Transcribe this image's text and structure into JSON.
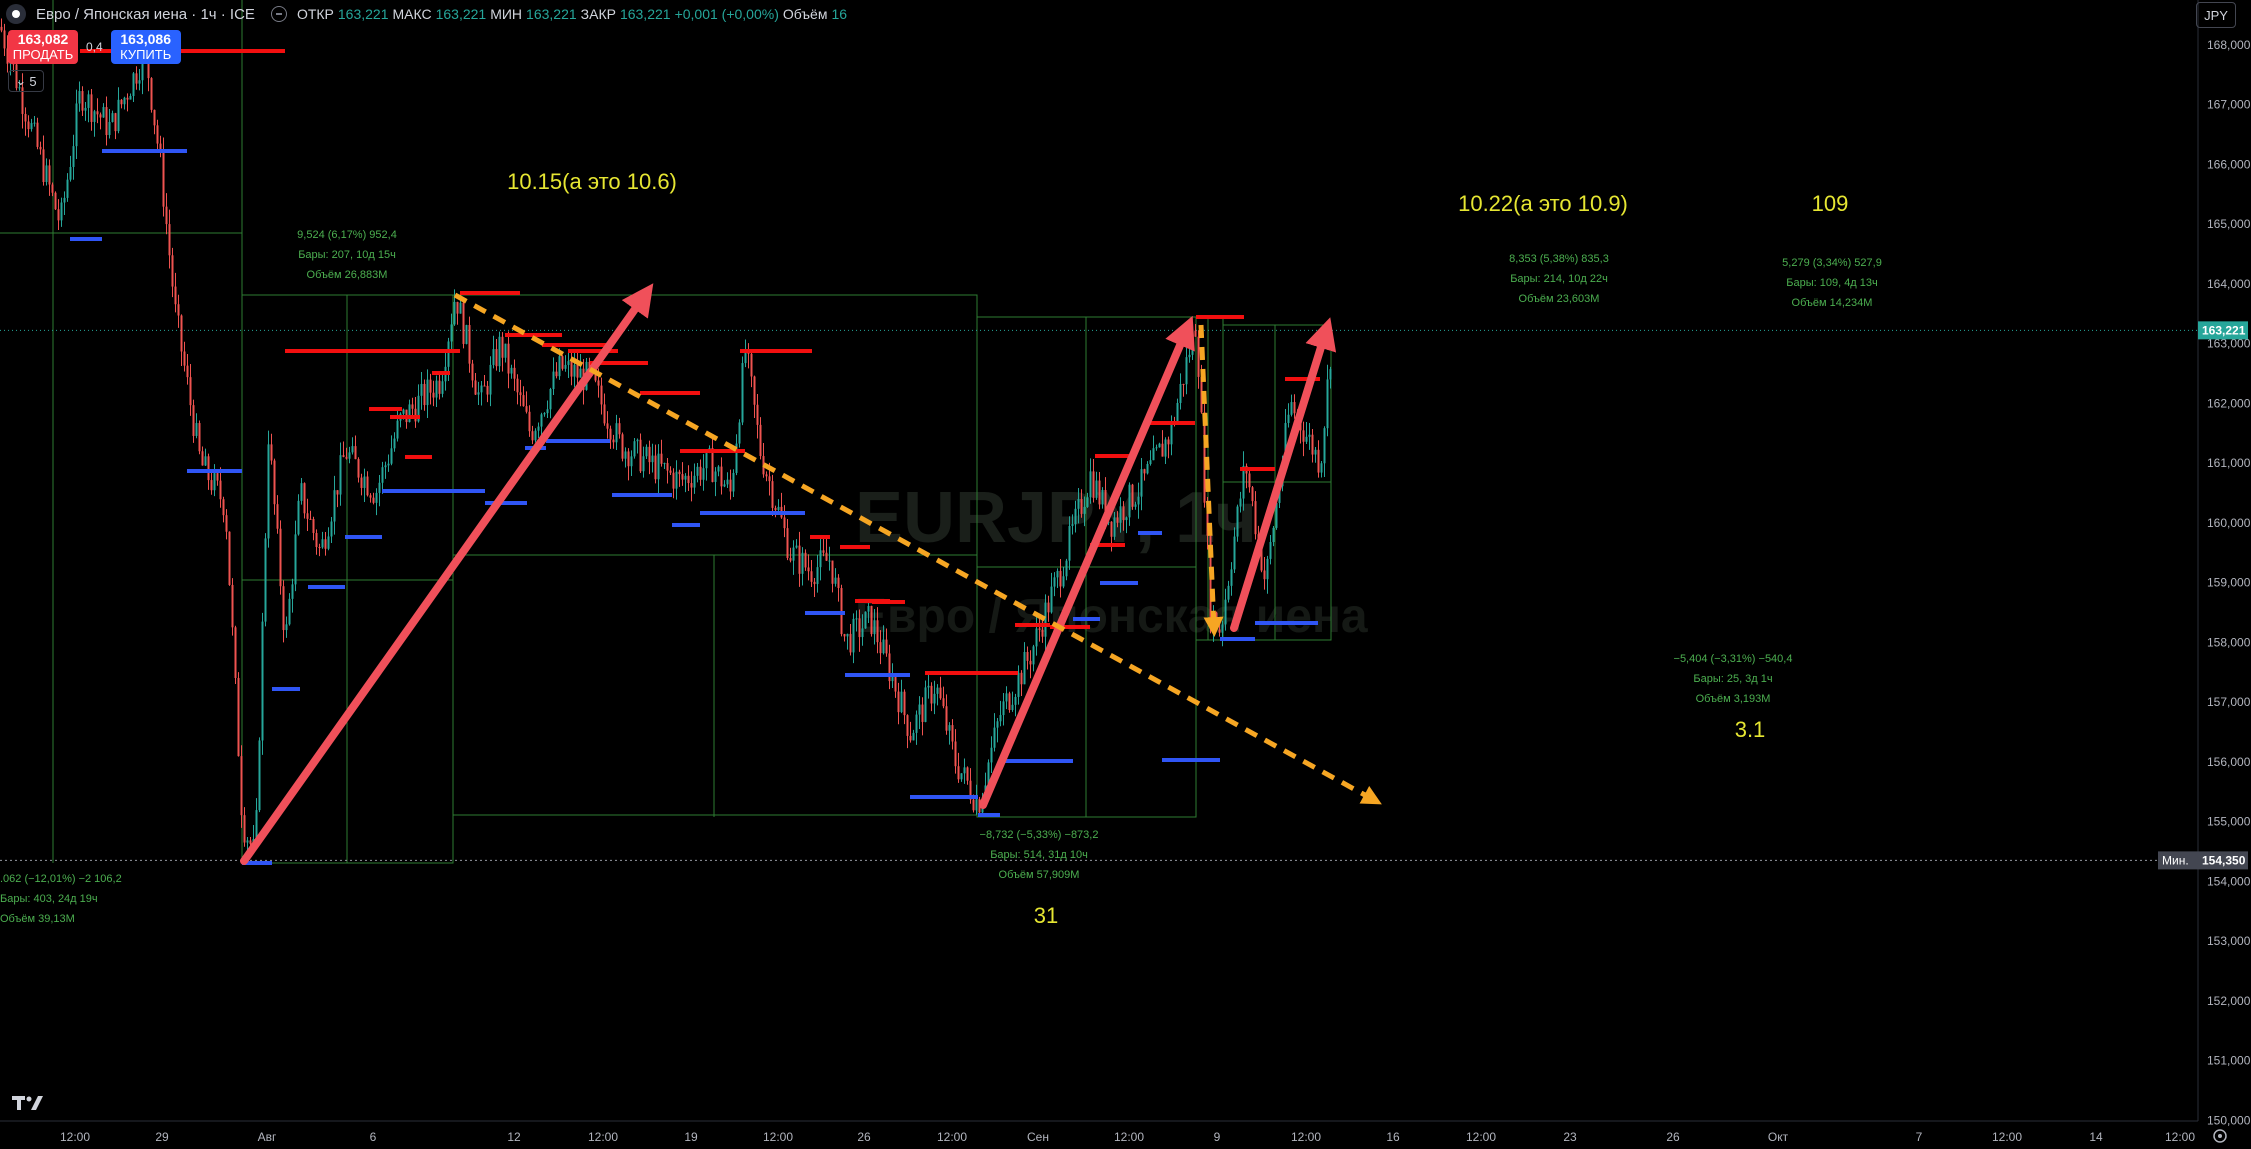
{
  "header": {
    "symbol": "Евро / Японская иена · 1ч · ICE",
    "ohlc": [
      {
        "label": "ОТКР",
        "value": "163,221"
      },
      {
        "label": "МАКС",
        "value": "163,221"
      },
      {
        "label": "МИН",
        "value": "163,221"
      },
      {
        "label": "ЗАКР",
        "value": "163,221"
      },
      {
        "label": "",
        "value": "+0,001 (+0,00%)"
      },
      {
        "label": "Объём",
        "value": "16"
      }
    ]
  },
  "trade": {
    "sell_price": "163,082",
    "sell_label": "ПРОДАТЬ",
    "spread": "0,4",
    "buy_price": "163,086",
    "buy_label": "КУПИТЬ",
    "collapse_count": "5"
  },
  "currency": "JPY",
  "watermark": {
    "line1": "EURJPY, 1ч",
    "line2": "Евро / Японская иена"
  },
  "colors": {
    "up": "#26a69a",
    "down": "#ef5350",
    "red_level": "#f20f0f",
    "blue_level": "#2f55f5",
    "arrow": "#f0505a",
    "dashed": "#f6a623",
    "annot": "#e6e632",
    "measure": "#2e7d32"
  },
  "chart_data": {
    "type": "candlestick",
    "y_axis": {
      "range": [
        150.2,
        168.5
      ],
      "ticks": [
        "168,000",
        "167,000",
        "166,000",
        "165,000",
        "164,000",
        "163,000",
        "162,000",
        "161,000",
        "160,000",
        "159,000",
        "158,000",
        "157,000",
        "156,000",
        "155,000",
        "154,000",
        "153,000",
        "152,000",
        "151,000",
        "150,000"
      ]
    },
    "x_axis": {
      "ticks": [
        "12:00",
        "29",
        "Авг",
        "6",
        "12",
        "12:00",
        "19",
        "12:00",
        "26",
        "12:00",
        "Сен",
        "12:00",
        "9",
        "12:00",
        "16",
        "12:00",
        "23",
        "26",
        "Окт",
        "7",
        "12:00",
        "14",
        "12:00"
      ]
    },
    "price_labels": [
      {
        "text": "163,221",
        "value": 163.221,
        "style": "current"
      },
      {
        "text": "154,350",
        "value": 154.35,
        "style": "min",
        "prefix": "Мин."
      }
    ],
    "annotations": [
      {
        "text": "10.15(а это 10.6)"
      },
      {
        "text": "10.22(а это 10.9)"
      },
      {
        "text": "109"
      },
      {
        "text": "3.1"
      },
      {
        "text": "31"
      }
    ],
    "measures": [
      {
        "lines": [
          ".062 (−12,01%) −2 106,2",
          "Бары: 403, 24д 19ч",
          "Объём 39,13M"
        ]
      },
      {
        "lines": [
          "9,524 (6,17%) 952,4",
          "Бары: 207, 10д 15ч",
          "Объём 26,883M"
        ]
      },
      {
        "lines": [
          "−8,732 (−5,33%) −873,2",
          "Бары: 514, 31д 10ч",
          "Объём 57,909M"
        ]
      },
      {
        "lines": [
          "8,353 (5,38%) 835,3",
          "Бары: 214, 10д 22ч",
          "Объём 23,603M"
        ]
      },
      {
        "lines": [
          "5,279 (3,34%) 527,9",
          "Бары: 109, 4д 13ч",
          "Объём 14,234M"
        ]
      },
      {
        "lines": [
          "−5,404 (−3,31%) −540,4",
          "Бары: 25, 3д 1ч",
          "Объём 3,193M"
        ]
      }
    ],
    "path": [
      [
        0,
        168.3
      ],
      [
        60,
        165.0
      ],
      [
        80,
        167.2
      ],
      [
        110,
        166.6
      ],
      [
        145,
        167.9
      ],
      [
        160,
        166.0
      ],
      [
        175,
        163.5
      ],
      [
        200,
        161.0
      ],
      [
        225,
        160.3
      ],
      [
        242,
        155.0
      ],
      [
        255,
        154.4
      ],
      [
        268,
        161.5
      ],
      [
        285,
        158.0
      ],
      [
        300,
        160.5
      ],
      [
        320,
        159.5
      ],
      [
        345,
        161.2
      ],
      [
        375,
        160.5
      ],
      [
        400,
        161.7
      ],
      [
        440,
        162.4
      ],
      [
        455,
        163.85
      ],
      [
        480,
        162.0
      ],
      [
        500,
        163.0
      ],
      [
        530,
        161.5
      ],
      [
        560,
        162.6
      ],
      [
        590,
        162.4
      ],
      [
        620,
        161.3
      ],
      [
        650,
        161.0
      ],
      [
        680,
        160.7
      ],
      [
        710,
        161.0
      ],
      [
        730,
        160.5
      ],
      [
        745,
        162.9
      ],
      [
        760,
        161.2
      ],
      [
        790,
        159.5
      ],
      [
        810,
        159.2
      ],
      [
        830,
        159.4
      ],
      [
        845,
        158.0
      ],
      [
        870,
        158.4
      ],
      [
        890,
        157.5
      ],
      [
        910,
        156.5
      ],
      [
        935,
        157.3
      ],
      [
        955,
        156.0
      ],
      [
        978,
        155.3
      ],
      [
        1000,
        156.8
      ],
      [
        1030,
        157.8
      ],
      [
        1060,
        159.2
      ],
      [
        1090,
        160.8
      ],
      [
        1110,
        160.0
      ],
      [
        1140,
        160.6
      ],
      [
        1170,
        161.5
      ],
      [
        1196,
        163.4
      ],
      [
        1210,
        158.5
      ],
      [
        1220,
        158.2
      ],
      [
        1245,
        161.0
      ],
      [
        1265,
        159.0
      ],
      [
        1290,
        162.0
      ],
      [
        1320,
        161.0
      ],
      [
        1332,
        163.2
      ]
    ]
  }
}
